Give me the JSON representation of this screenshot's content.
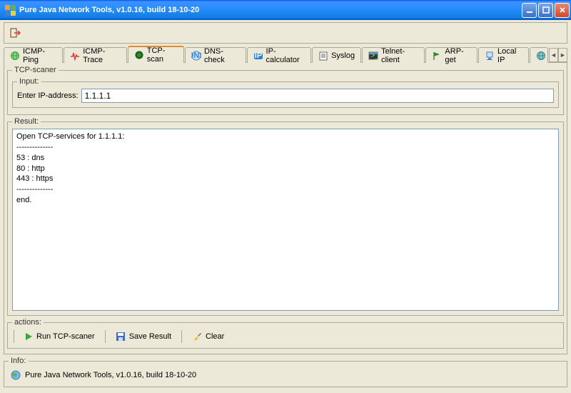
{
  "window": {
    "title": "Pure Java Network Tools,  v1.0.16, build 18-10-20"
  },
  "tabs": [
    {
      "label": "ICMP-Ping",
      "icon": "globe",
      "color": "#3aa53a"
    },
    {
      "label": "ICMP-Trace",
      "icon": "pulse",
      "color": "#d43a3a"
    },
    {
      "label": "TCP-scan",
      "icon": "dot",
      "color": "#2a8f2a",
      "active": true
    },
    {
      "label": "DNS-check",
      "icon": "dns",
      "color": "#3a7fd4"
    },
    {
      "label": "IP-calculator",
      "icon": "ip",
      "color": "#2a7fd4"
    },
    {
      "label": "Syslog",
      "icon": "log",
      "color": "#6a6a6a"
    },
    {
      "label": "Telnet-client",
      "icon": "term",
      "color": "#6a6a6a"
    },
    {
      "label": "ARP-get",
      "icon": "flag",
      "color": "#2a8f2a"
    },
    {
      "label": "Local IP",
      "icon": "host",
      "color": "#4a7fc4"
    }
  ],
  "panel": {
    "title": "TCP-scaner",
    "input_title": "Input:",
    "input_label": "Enter IP-address:",
    "input_value": "1.1.1.1",
    "result_title": "Result:",
    "result_text": "Open TCP-services for 1.1.1.1:\n--------------\n53 : dns\n80 : http\n443 : https\n--------------\nend.",
    "actions_title": "actions:",
    "actions": {
      "run": "Run TCP-scaner",
      "save": "Save Result",
      "clear": "Clear"
    }
  },
  "info": {
    "title": "Info:",
    "text": " Pure Java Network Tools,  v1.0.16, build 18-10-20"
  }
}
